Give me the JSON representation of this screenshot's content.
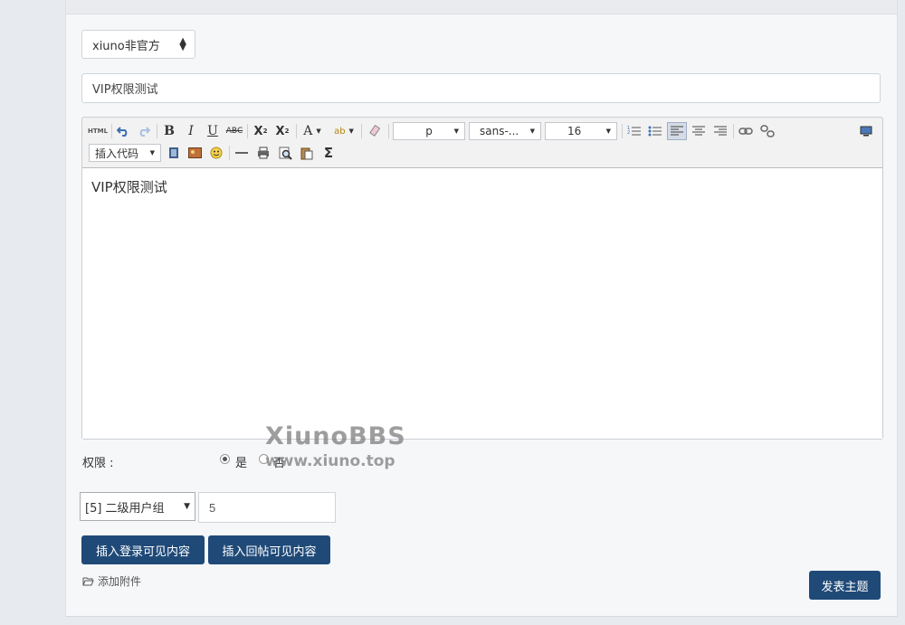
{
  "forum_select": {
    "value": "xiuno非官方"
  },
  "subject": {
    "value": "VIP权限测试"
  },
  "editor": {
    "toolbar": {
      "html_label": "HTML",
      "format_value": "p",
      "font_value": "sans-...",
      "size_value": "16",
      "insert_code_value": "插入代码"
    },
    "content": "VIP权限测试"
  },
  "permission": {
    "label": "权限 :",
    "yes_label": "是",
    "no_label": "否",
    "selected": "是"
  },
  "group_select": {
    "value": "[5] 二级用户组"
  },
  "group_number": {
    "value": "5"
  },
  "buttons": {
    "insert_login_visible": "插入登录可见内容",
    "insert_reply_visible": "插入回帖可见内容",
    "publish": "发表主题"
  },
  "attachment": {
    "label": "添加附件"
  },
  "watermark": {
    "line1": "XiunoBBS",
    "line2": "www.xiuno.top"
  },
  "colors": {
    "primary_button": "#1f4a78",
    "background": "#e7eaee",
    "card": "#f6f7f9"
  }
}
